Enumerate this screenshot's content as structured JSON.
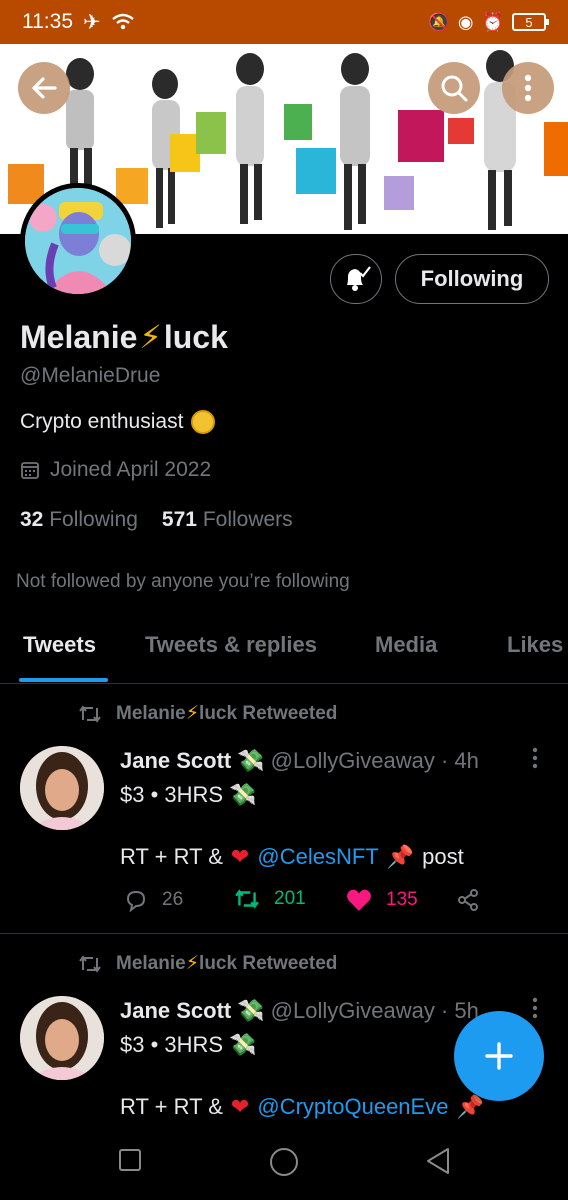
{
  "status_bar": {
    "time": "11:35",
    "battery": "5"
  },
  "profile": {
    "display_name_part1": "Melanie",
    "display_name_part2": "luck",
    "bolt": "⚡",
    "handle": "@MelanieDrue",
    "bio": "Crypto enthusiast",
    "joined": "Joined April 2022",
    "following_count": "32",
    "following_label": "Following",
    "followers_count": "571",
    "followers_label": "Followers",
    "not_followed_note": "Not followed by anyone you’re following",
    "follow_button_label": "Following"
  },
  "tabs": [
    {
      "label": "Tweets",
      "active": true
    },
    {
      "label": "Tweets & replies",
      "active": false
    },
    {
      "label": "Media",
      "active": false
    },
    {
      "label": "Likes",
      "active": false
    }
  ],
  "tweets": [
    {
      "retweet_by_part1": "Melanie",
      "retweet_by_part2": "luck Retweeted",
      "author": "Jane Scott",
      "author_emoji": "💸",
      "handle_time": "@LollyGiveaway · 4h",
      "line1": "$3 • 3HRS",
      "line1_emoji": "💸",
      "line2_start": "RT + RT &",
      "heart": "❤",
      "mention": "@CelesNFT",
      "pin": "📌",
      "line2_end": "post",
      "replies": "26",
      "retweets": "201",
      "likes": "135"
    },
    {
      "retweet_by_part1": "Melanie",
      "retweet_by_part2": "luck Retweeted",
      "author": "Jane Scott",
      "author_emoji": "💸",
      "handle_time": "@LollyGiveaway · 5h",
      "line1": "$3 • 3HRS",
      "line1_emoji": "💸",
      "line2_start": "RT + RT &",
      "heart": "❤",
      "mention": "@CryptoQueenEve",
      "pin": "📌"
    }
  ],
  "colors": {
    "accent": "#1d9bf0",
    "status_bar": "#b84a00",
    "retweet_green": "#00ba7c",
    "like_pink": "#f91880",
    "muted": "#71767b"
  },
  "icons": [
    "back-arrow-icon",
    "search-icon",
    "more-vertical-icon",
    "bell-subscribed-icon",
    "calendar-icon",
    "retweet-icon",
    "reply-icon",
    "like-icon",
    "share-icon",
    "compose-plus-icon",
    "nav-recents-icon",
    "nav-home-icon",
    "nav-back-icon"
  ]
}
